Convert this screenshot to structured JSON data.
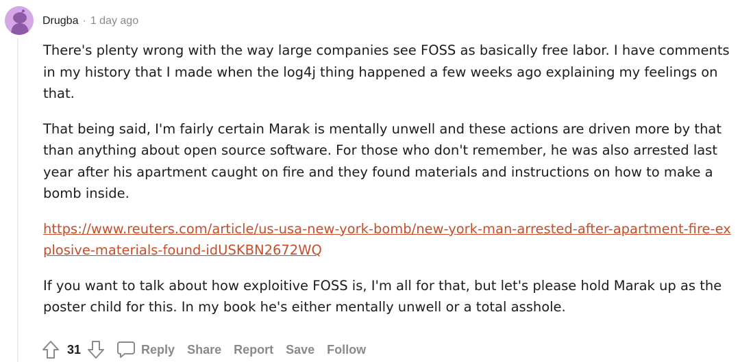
{
  "comment": {
    "author": "Drugba",
    "separator": "·",
    "timestamp": "1 day ago",
    "paragraphs": [
      "There's plenty wrong with the way large companies see FOSS as basically free labor. I have comments in my history that I made when the log4j thing happened a few weeks ago explaining my feelings on that.",
      "That being said, I'm fairly certain Marak is mentally unwell and these actions are driven more by that than anything about open source software. For those who don't remember, he was also arrested last year after his apartment caught on fire and they found materials and instructions on how to make a bomb inside."
    ],
    "link": "https://www.reuters.com/article/us-usa-new-york-bomb/new-york-man-arrested-after-apartment-fire-explosive-materials-found-idUSKBN2672WQ",
    "closing_paragraph": "If you want to talk about how exploitive FOSS is, I'm all for that, but let's please hold Marak up as the poster child for this. In my book he's either mentally unwell or a total asshole."
  },
  "actions": {
    "score": "31",
    "reply_label": "Reply",
    "share_label": "Share",
    "report_label": "Report",
    "save_label": "Save",
    "follow_label": "Follow"
  },
  "icons": {
    "avatar": "snoo-avatar-icon",
    "upvote": "upvote-arrow-icon",
    "downvote": "downvote-arrow-icon",
    "reply": "comment-bubble-icon"
  },
  "colors": {
    "link": "#c74d2a",
    "muted": "#878a8c",
    "text": "#1c1c1c",
    "avatar_bg": "#d4a8e6",
    "thread_line": "#edeff1"
  }
}
